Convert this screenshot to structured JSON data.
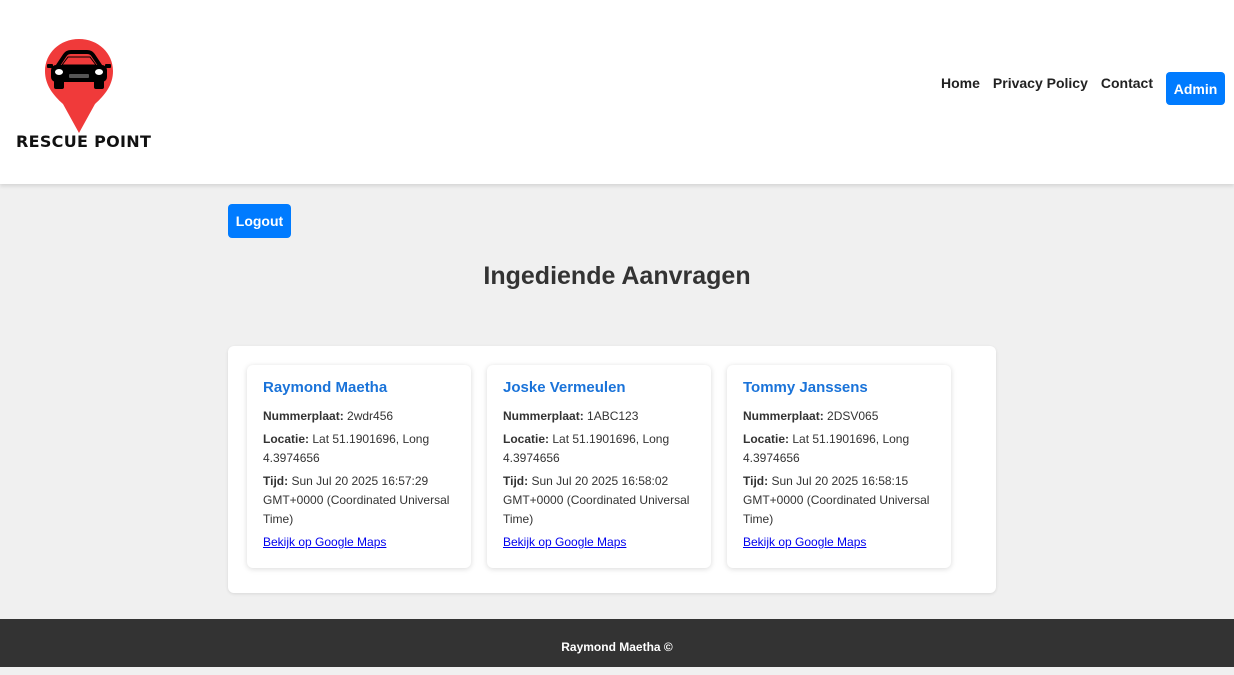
{
  "header": {
    "logo_text": "RESCUE POINT",
    "logo_icon": "car-location-pin-icon",
    "nav": [
      {
        "label": "Home"
      },
      {
        "label": "Privacy Policy"
      },
      {
        "label": "Contact"
      }
    ],
    "admin_label": "Admin"
  },
  "logout_label": "Logout",
  "page_title": "Ingediende Aanvragen",
  "labels": {
    "plate": "Nummerplaat:",
    "location": "Locatie:",
    "time": "Tijd:",
    "maps_link": "Bekijk op Google Maps"
  },
  "requests": [
    {
      "name": "Raymond Maetha",
      "plate": "2wdr456",
      "location": "Lat 51.1901696, Long 4.3974656",
      "time": "Sun Jul 20 2025 16:57:29 GMT+0000 (Coordinated Universal Time)"
    },
    {
      "name": "Joske Vermeulen",
      "plate": "1ABC123",
      "location": "Lat 51.1901696, Long 4.3974656",
      "time": "Sun Jul 20 2025 16:58:02 GMT+0000 (Coordinated Universal Time)"
    },
    {
      "name": "Tommy Janssens",
      "plate": "2DSV065",
      "location": "Lat 51.1901696, Long 4.3974656",
      "time": "Sun Jul 20 2025 16:58:15 GMT+0000 (Coordinated Universal Time)"
    }
  ],
  "footer_text": "Raymond Maetha ©",
  "colors": {
    "accent": "#007bff",
    "name_link": "#1a73d9",
    "pin_red": "#f03a3a",
    "footer_bg": "#333333",
    "page_bg": "#f0f0f0"
  }
}
